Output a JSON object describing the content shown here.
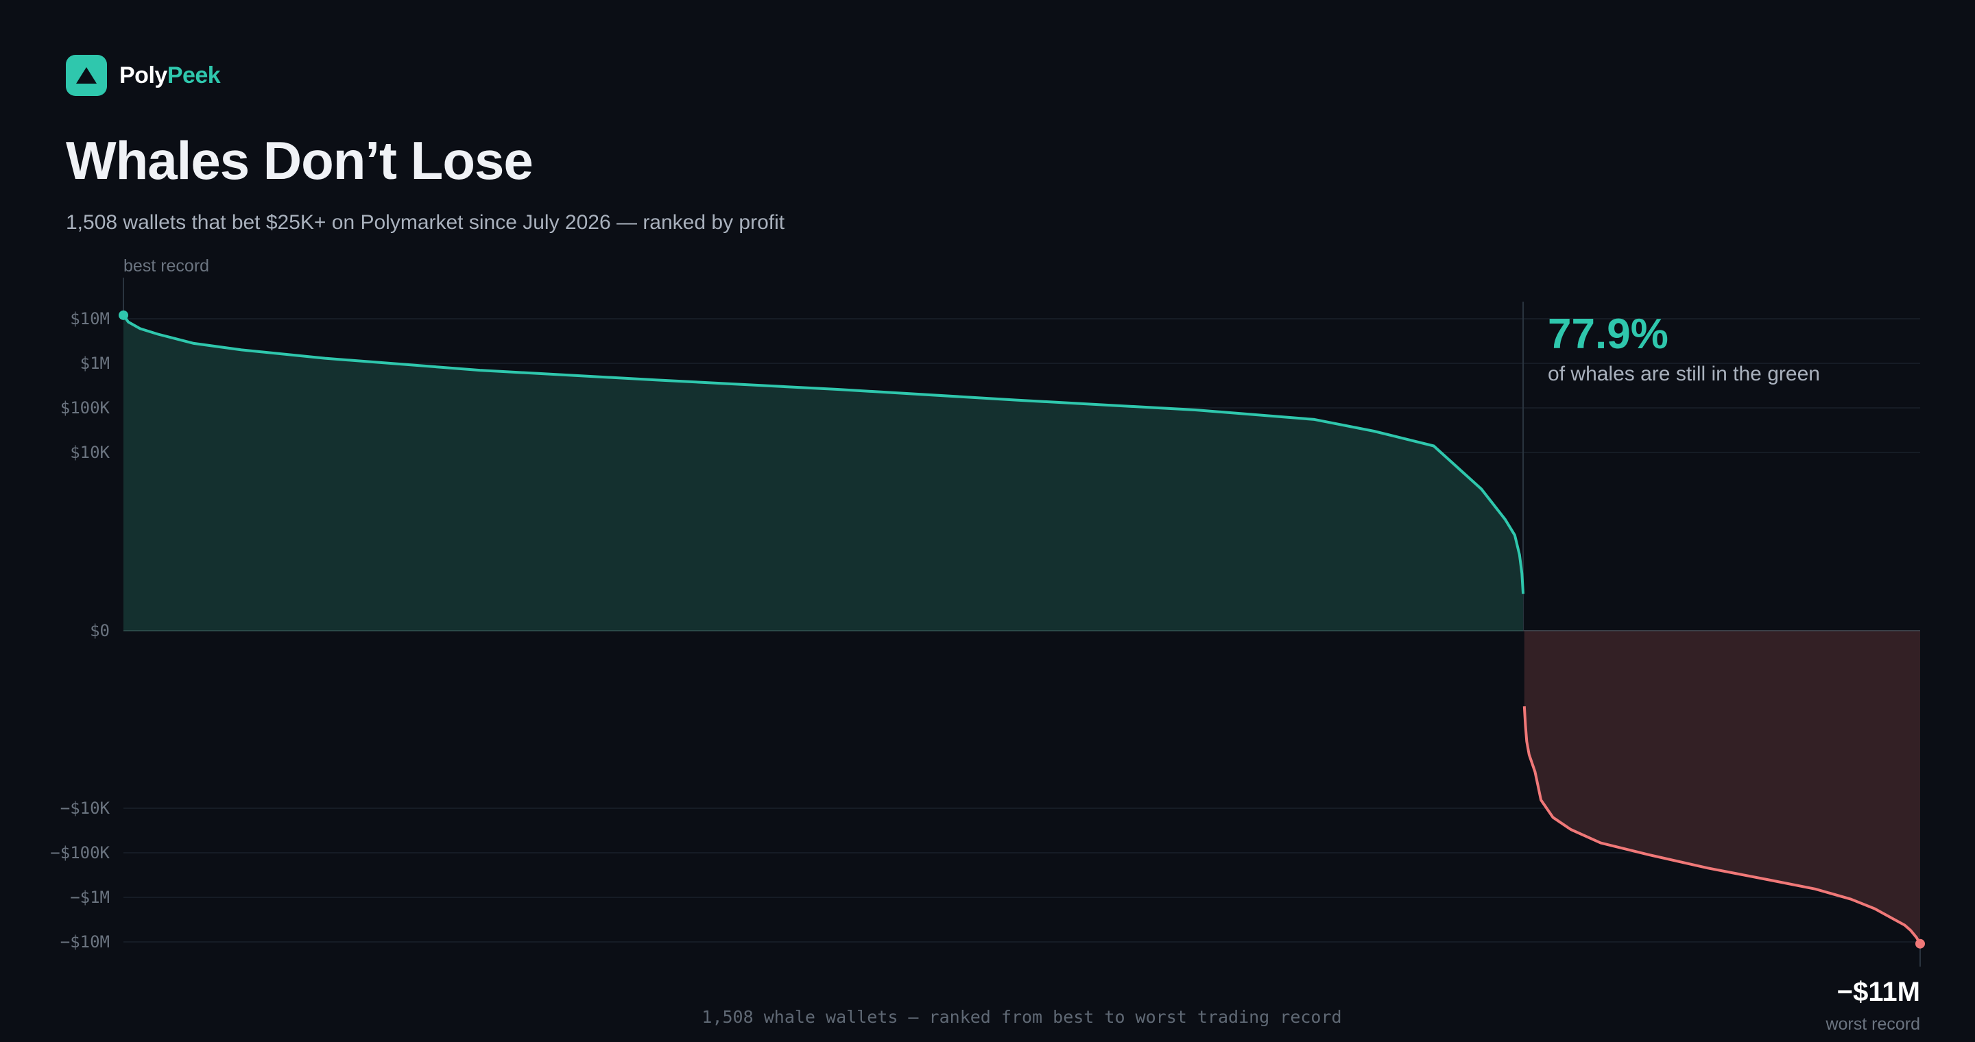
{
  "brand": {
    "name_part1": "Poly",
    "name_part2": "Peek"
  },
  "header": {
    "title": "Whales Don’t Lose",
    "subtitle": "1,508 wallets that bet $25K+ on Polymarket since July 2026 — ranked by profit"
  },
  "annotations": {
    "best_label": "best record",
    "percent": "77.9%",
    "percent_note": "of whales are still in the green",
    "worst_value": "−$11M",
    "worst_label": "worst record",
    "footer": "1,508 whale wallets — ranked from best to worst trading record"
  },
  "colors": {
    "positive": "#2fc7ad",
    "negative": "#f07878",
    "background": "#0b0e15"
  },
  "chart_data": {
    "type": "area",
    "scale": "symmetric-log",
    "xlabel": "1,508 whale wallets — ranked from best to worst trading record",
    "x_range": [
      1,
      1508
    ],
    "y_ticks": [
      {
        "value": 10000000,
        "label": "$10M"
      },
      {
        "value": 1000000,
        "label": "$1M"
      },
      {
        "value": 100000,
        "label": "$100K"
      },
      {
        "value": 10000,
        "label": "$10K"
      },
      {
        "value": 0,
        "label": "$0"
      },
      {
        "value": -10000,
        "label": "−$10K"
      },
      {
        "value": -100000,
        "label": "−$100K"
      },
      {
        "value": -1000000,
        "label": "−$1M"
      },
      {
        "value": -10000000,
        "label": "−$10M"
      }
    ],
    "grid": true,
    "split_rank": 1175,
    "positive_share_pct": 77.9,
    "series": [
      {
        "name": "",
        "sign": "positive",
        "x": [
          1,
          5,
          15,
          30,
          60,
          100,
          170,
          300,
          450,
          600,
          750,
          900,
          1000,
          1050,
          1100,
          1140,
          1160,
          1168,
          1172,
          1174,
          1175
        ],
        "y": [
          12000000,
          8500000,
          6000000,
          4500000,
          2800000,
          2000000,
          1300000,
          700000,
          420000,
          260000,
          150000,
          90000,
          55000,
          30000,
          14000,
          6000,
          3500,
          2500,
          1500,
          800,
          300
        ]
      },
      {
        "name": "",
        "sign": "negative",
        "x": [
          1176,
          1177,
          1178,
          1180,
          1185,
          1190,
          1200,
          1215,
          1240,
          1280,
          1330,
          1380,
          1420,
          1450,
          1470,
          1485,
          1495,
          1500,
          1505,
          1508
        ],
        "y": [
          -1500,
          -2500,
          -3500,
          -4500,
          -6000,
          -9000,
          -16000,
          -30000,
          -60000,
          -110000,
          -220000,
          -400000,
          -650000,
          -1100000,
          -1800000,
          -3000000,
          -4200000,
          -5500000,
          -8000000,
          -11000000
        ]
      }
    ]
  }
}
